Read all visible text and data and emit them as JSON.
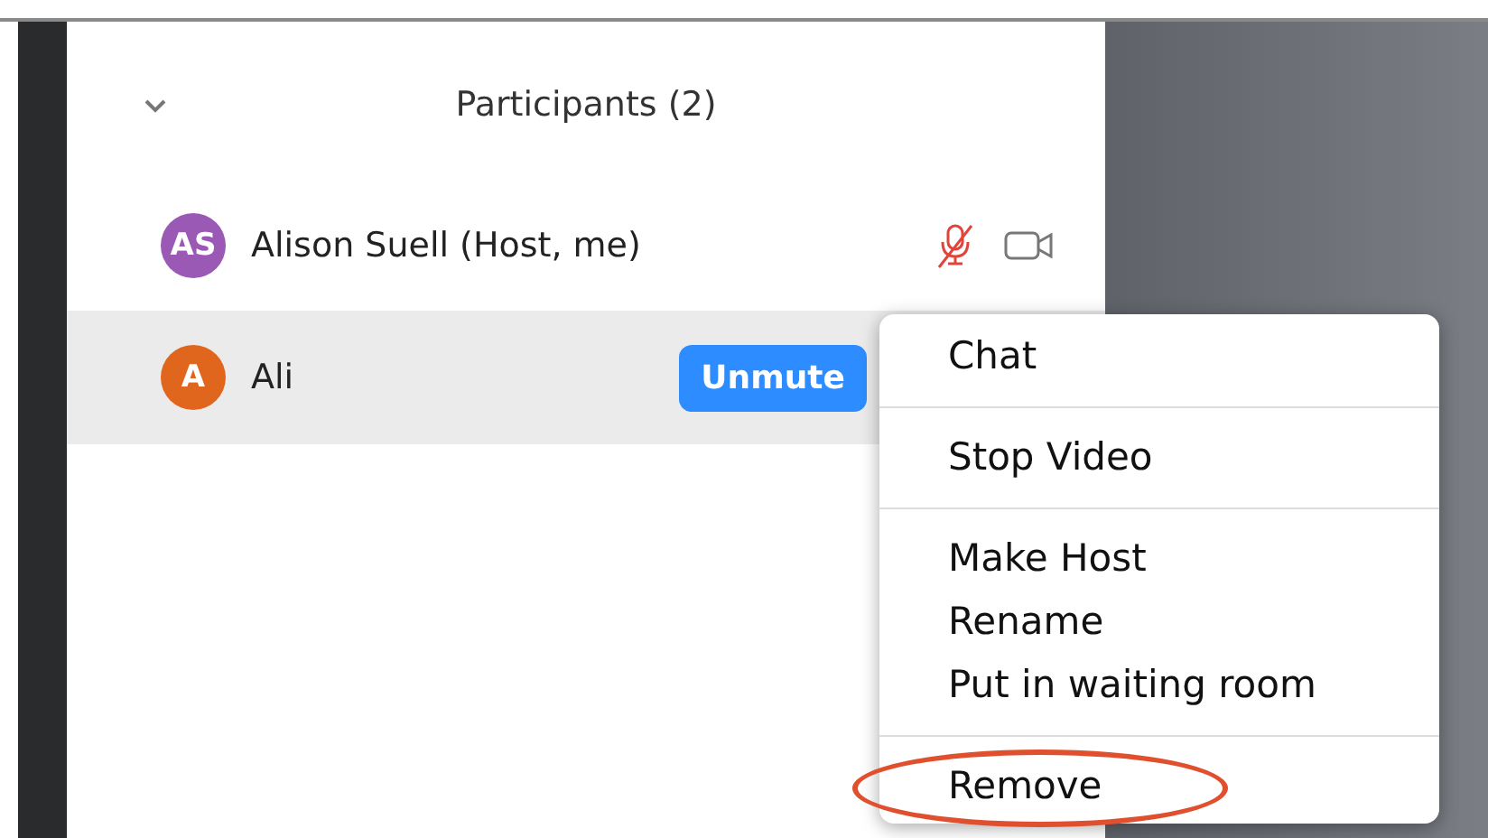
{
  "panel": {
    "title": "Participants (2)",
    "expanded": true
  },
  "participants": [
    {
      "initials": "AS",
      "name": "Alison Suell (Host, me)",
      "color": "#9b59b6",
      "selected": false,
      "muted": true
    },
    {
      "initials": "A",
      "name": "Ali",
      "color": "#e0661e",
      "selected": true,
      "button": "Unmute"
    }
  ],
  "context_menu": {
    "groups": [
      [
        {
          "label": "Chat",
          "circled": false
        }
      ],
      [
        {
          "label": "Stop Video",
          "circled": false
        }
      ],
      [
        {
          "label": "Make Host",
          "circled": false
        },
        {
          "label": "Rename",
          "circled": false
        },
        {
          "label": "Put in waiting room",
          "circled": false
        }
      ],
      [
        {
          "label": "Remove",
          "circled": true
        }
      ]
    ]
  }
}
